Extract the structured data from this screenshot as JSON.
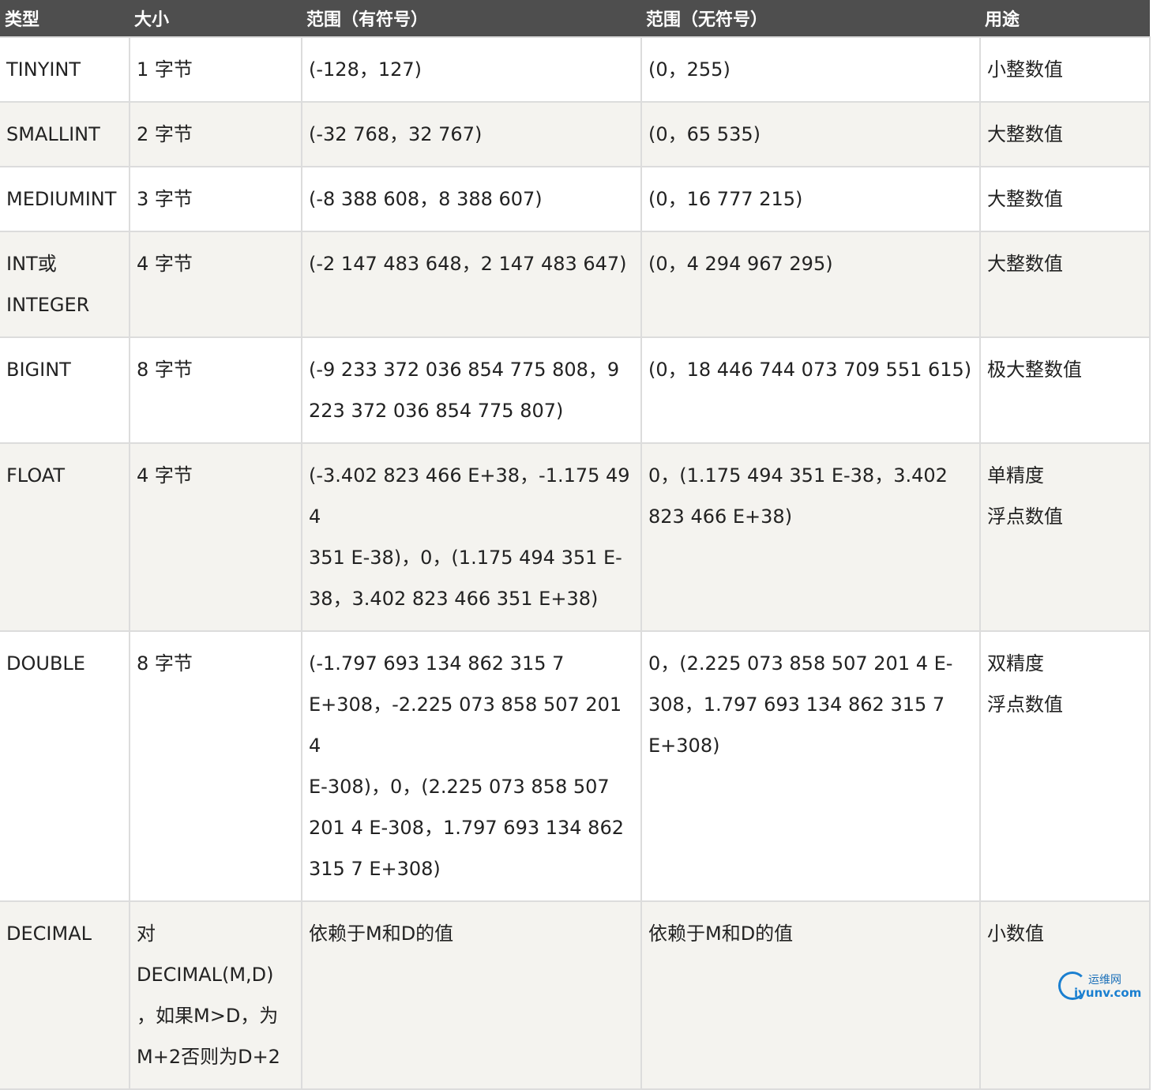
{
  "headers": [
    "类型",
    "大小",
    "范围（有符号）",
    "范围（无符号）",
    "用途"
  ],
  "rows": [
    {
      "type": [
        "TINYINT"
      ],
      "size": [
        "1 字节"
      ],
      "signed": [
        "(-128，127)"
      ],
      "unsigned": [
        "(0，255)"
      ],
      "use": [
        "小整数值"
      ]
    },
    {
      "type": [
        "SMALLINT"
      ],
      "size": [
        "2 字节"
      ],
      "signed": [
        "(-32 768，32 767)"
      ],
      "unsigned": [
        "(0，65 535)"
      ],
      "use": [
        "大整数值"
      ]
    },
    {
      "type": [
        "MEDIUMINT"
      ],
      "size": [
        "3 字节"
      ],
      "signed": [
        "(-8 388 608，8 388 607)"
      ],
      "unsigned": [
        "(0，16 777 215)"
      ],
      "use": [
        "大整数值"
      ]
    },
    {
      "type": [
        "INT或",
        "INTEGER"
      ],
      "size": [
        "4 字节"
      ],
      "signed": [
        "(-2 147 483 648，2 147 483 647)"
      ],
      "unsigned": [
        "(0，4 294 967 295)"
      ],
      "use": [
        "大整数值"
      ]
    },
    {
      "type": [
        "BIGINT"
      ],
      "size": [
        "8 字节"
      ],
      "signed": [
        "(-9 233 372 036 854 775 808，9",
        "223 372 036 854 775 807)"
      ],
      "unsigned": [
        "(0，18 446 744 073 709 551 615)"
      ],
      "use": [
        "极大整数值"
      ]
    },
    {
      "type": [
        "FLOAT"
      ],
      "size": [
        "4 字节"
      ],
      "signed": [
        "(-3.402 823 466 E+38，-1.175 494",
        "351 E-38)，0，(1.175 494 351 E-",
        "38，3.402 823 466 351 E+38)"
      ],
      "unsigned": [
        "0，(1.175 494 351 E-38，3.402",
        "823 466 E+38)"
      ],
      "use": [
        "单精度",
        "浮点数值"
      ]
    },
    {
      "type": [
        "DOUBLE"
      ],
      "size": [
        "8 字节"
      ],
      "signed": [
        "(-1.797 693 134 862 315 7",
        "E+308，-2.225 073 858 507 201 4",
        "E-308)，0，(2.225 073 858 507",
        "201 4 E-308，1.797 693 134 862",
        "315 7 E+308)"
      ],
      "unsigned": [
        "0，(2.225 073 858 507 201 4 E-",
        "308，1.797 693 134 862 315 7",
        "E+308)"
      ],
      "use": [
        "双精度",
        "浮点数值"
      ]
    },
    {
      "type": [
        "DECIMAL"
      ],
      "size": [
        "对",
        "DECIMAL(M,D)",
        "，如果M>D，为",
        "M+2否则为D+2"
      ],
      "signed": [
        "依赖于M和D的值"
      ],
      "unsigned": [
        "依赖于M和D的值"
      ],
      "use": [
        "小数值"
      ]
    }
  ],
  "watermark": {
    "top": "运维网",
    "bottom": "iyunv.com",
    "icon": "logo-arc-icon"
  },
  "colors": {
    "header_bg": "#4e4e4e",
    "header_text": "#ffffff",
    "row_alt_bg": "#f4f3ef",
    "border": "#dcdcdc"
  }
}
